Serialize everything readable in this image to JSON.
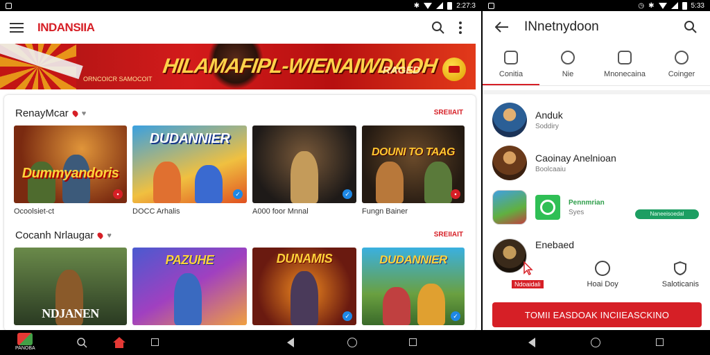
{
  "left": {
    "status": {
      "time": "2:27:3"
    },
    "appbar": {
      "brand": "INDANSIIA"
    },
    "banner": {
      "title": "HILAMAFIPL-WIENAIWDAOH",
      "subtitle": "ORNCOICR SAMOCOIT",
      "cta": "RAGED"
    },
    "section1": {
      "title": "RenayMcar",
      "see_more": "SREIIAIT",
      "cards": [
        {
          "art": "Dummyandoris",
          "caption": "Ocoolsiet-ct"
        },
        {
          "art": "DUDANNIER",
          "caption": "DOCC Arhalis"
        },
        {
          "art": "",
          "caption": "A000 foor Mnnal"
        },
        {
          "art": "DOUNI TO TAAG",
          "caption": "Fungn Bainer"
        }
      ]
    },
    "section2": {
      "title": "Cocanh Nrlaugar",
      "see_more": "SREIIAIT",
      "cards": [
        {
          "art": "NDJANEN"
        },
        {
          "art": "PAZUHE"
        },
        {
          "art": "DUNAMIS"
        },
        {
          "art": "DUDANNIER"
        }
      ]
    },
    "bottom_nav": {
      "home_label": "PANOBA"
    }
  },
  "right": {
    "status": {
      "time": "5:33"
    },
    "appbar": {
      "title": "INnetnydoon"
    },
    "tabs": [
      {
        "label": "Conitia"
      },
      {
        "label": "Nie"
      },
      {
        "label": "Mnonecaina"
      },
      {
        "label": "Coinger"
      }
    ],
    "list": [
      {
        "name": "Anduk",
        "sub": "Soddiry"
      },
      {
        "name": "Caoinay Anelnioan",
        "sub": "Boolcaaiu"
      },
      {
        "name": "Pennmrian",
        "sub": "Syes",
        "action": "Naneeisoedal"
      },
      {
        "name": "Enebaed"
      }
    ],
    "actions": [
      {
        "label": "Ndoaidali"
      },
      {
        "label": "Hoai Doy"
      },
      {
        "label": "Saloticanis"
      }
    ],
    "cta": "TOMII EASDOAK INCIIEASCKINO"
  }
}
